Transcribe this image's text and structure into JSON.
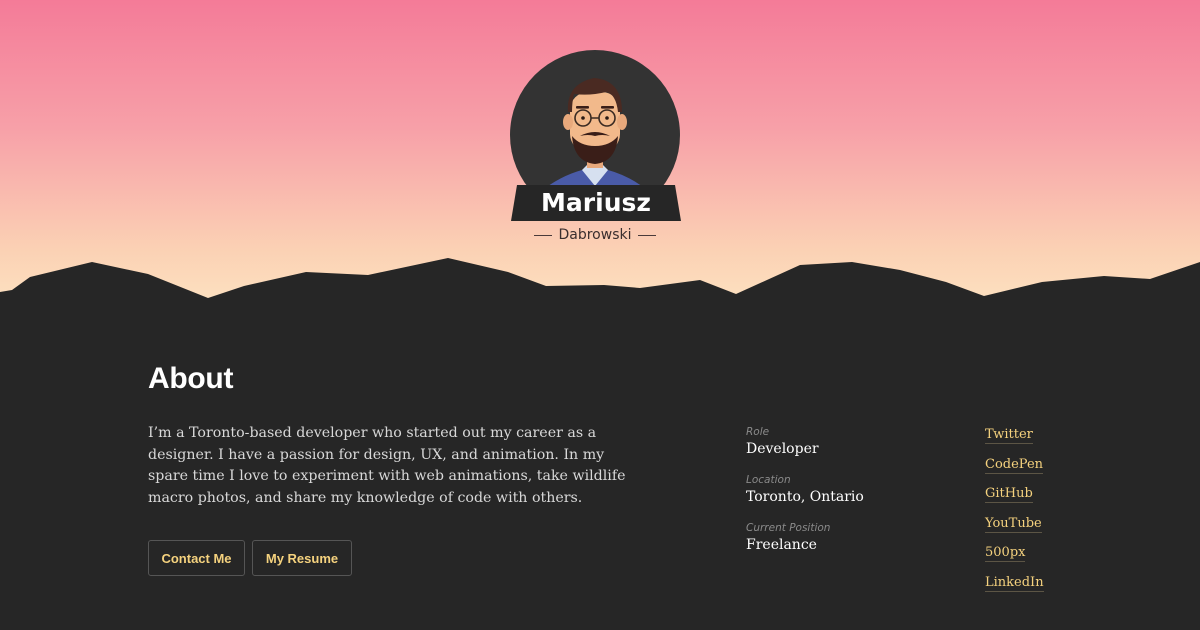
{
  "profile": {
    "first_name": "Mariusz",
    "last_name": "Dabrowski"
  },
  "about": {
    "title": "About",
    "bio": "I’m a Toronto-based developer who started out my career as a designer. I have a passion for design, UX, and animation. In my spare time I love to experiment with web animations, take wildlife macro photos, and share my knowledge of code with others."
  },
  "buttons": {
    "contact": "Contact Me",
    "resume": "My Resume"
  },
  "info": {
    "role_label": "Role",
    "role_value": "Developer",
    "location_label": "Location",
    "location_value": "Toronto, Ontario",
    "position_label": "Current Position",
    "position_value": "Freelance"
  },
  "social": {
    "twitter": "Twitter",
    "codepen": "CodePen",
    "github": "GitHub",
    "youtube": "YouTube",
    "fivehundredpx": "500px",
    "linkedin": "LinkedIn"
  },
  "colors": {
    "sky_top": "#f47b98",
    "sky_bottom": "#fde6c4",
    "background": "#262626",
    "accent": "#f5d27e"
  }
}
